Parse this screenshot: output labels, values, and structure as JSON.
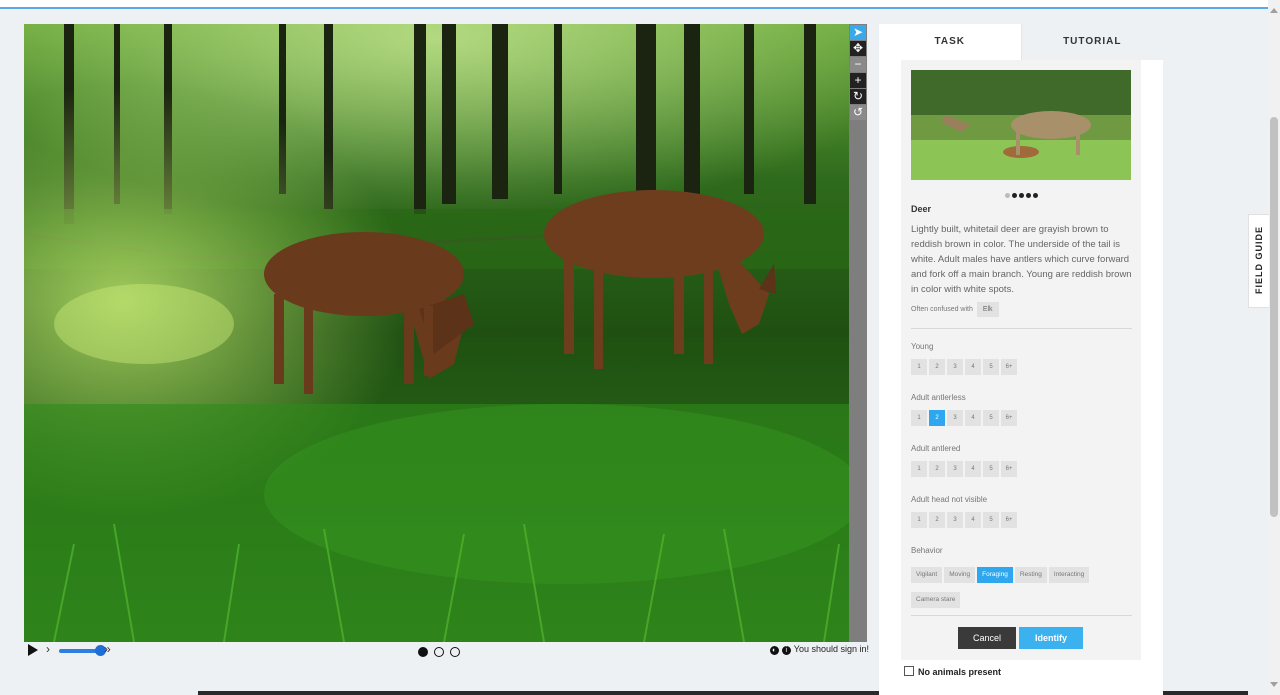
{
  "viewer": {
    "tools": [
      "pointer-icon",
      "move-icon",
      "zoom-out-icon",
      "zoom-in-icon",
      "rotate-icon",
      "reset-icon"
    ],
    "controls": {
      "play": "play-icon",
      "rewind": "›",
      "fast_forward": "»",
      "signin_text": "You should sign in!"
    },
    "frames": 3,
    "current_frame": 1
  },
  "panel": {
    "tabs": {
      "task": "TASK",
      "tutorial": "TUTORIAL"
    },
    "species": {
      "name": "Deer",
      "description": "Lightly built, whitetail deer are grayish brown to reddish brown in color. The underside of the tail is white. Adult males have antlers which curve forward and fork off a main branch. Young are reddish brown in color with white spots.",
      "confused_label": "Often confused with",
      "confused_with": "Elk"
    },
    "questions": {
      "young": "Young",
      "adult_antlerless": "Adult antlerless",
      "adult_antlered": "Adult antlered",
      "adult_head_not_visible": "Adult head not visible",
      "behavior": "Behavior"
    },
    "count_options": [
      "1",
      "2",
      "3",
      "4",
      "5",
      "6+"
    ],
    "selected": {
      "adult_antlerless": "2",
      "behavior": "Foraging"
    },
    "behaviors": [
      "Vigilant",
      "Moving",
      "Foraging",
      "Resting",
      "Interacting",
      "Camera stare"
    ],
    "buttons": {
      "cancel": "Cancel",
      "identify": "Identify"
    },
    "no_animals": "No animals present"
  },
  "field_guide": "FIELD GUIDE",
  "colors": {
    "accent": "#2ea7ee",
    "dark_button": "#3a3a3a"
  }
}
